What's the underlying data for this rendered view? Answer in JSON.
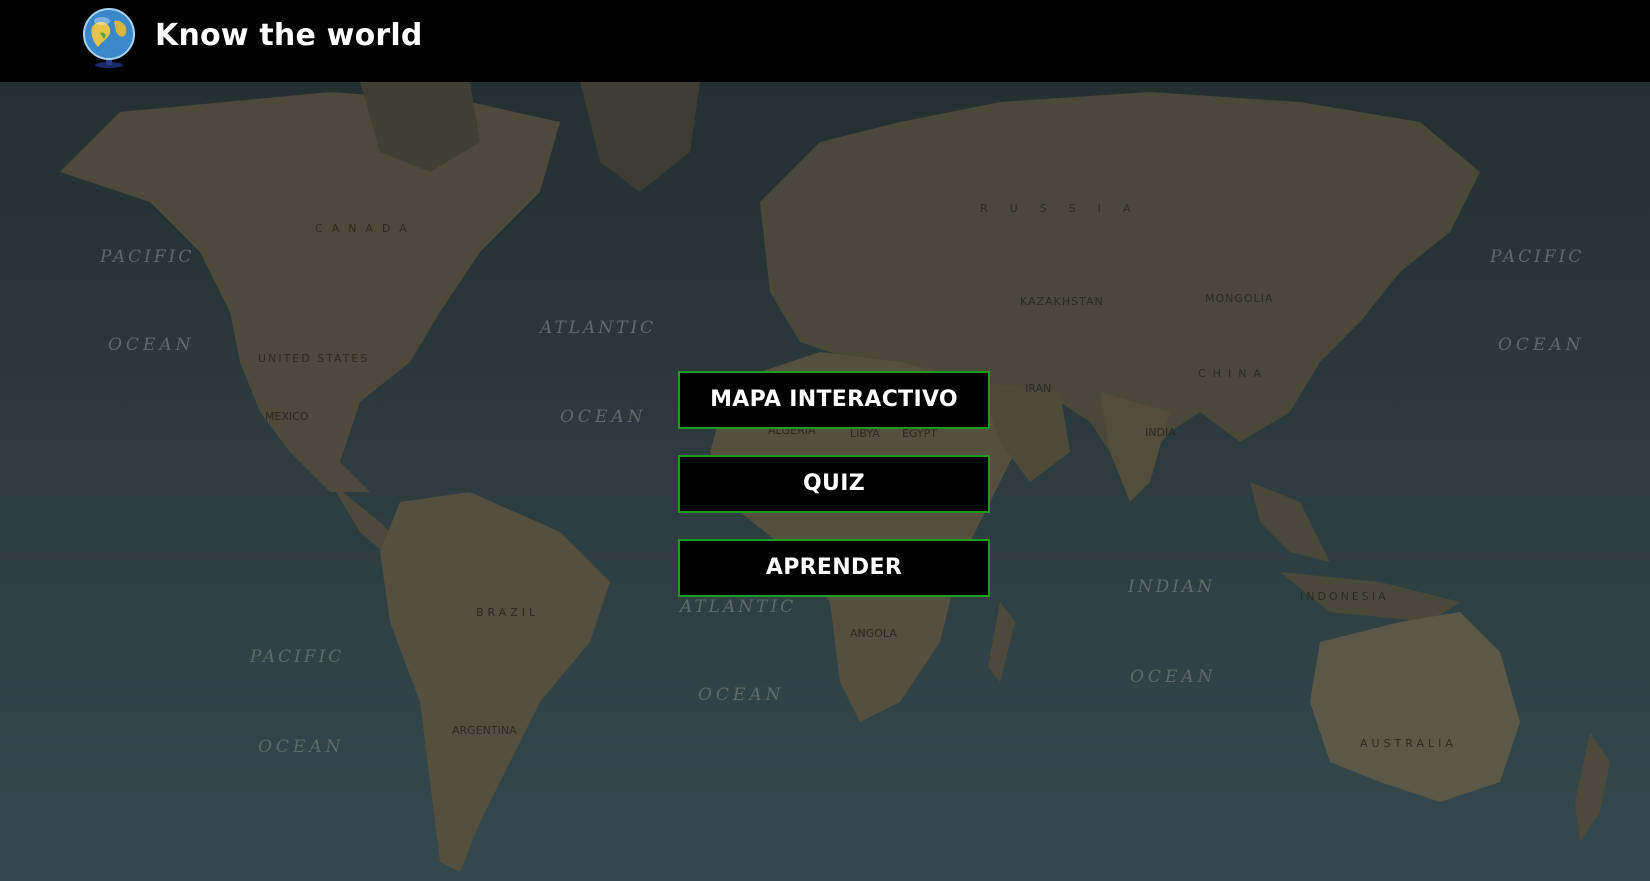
{
  "header": {
    "title": "Know the world",
    "logo_icon": "globe-icon"
  },
  "menu": {
    "items": [
      {
        "label": "MAPA INTERACTIVO"
      },
      {
        "label": "QUIZ"
      },
      {
        "label": "APRENDER"
      }
    ]
  },
  "map": {
    "oceans": [
      "PACIFIC",
      "OCEAN",
      "ATLANTIC",
      "OCEAN",
      "INDIAN",
      "OCEAN",
      "PACIFIC",
      "OCEAN",
      "ATLANTIC",
      "OCEAN",
      "PACIFIC",
      "OCEAN"
    ],
    "countries": [
      "CANADA",
      "UNITED STATES",
      "RUSSIA",
      "CHINA",
      "BRAZIL",
      "AUSTRALIA",
      "INDONESIA",
      "INDIA",
      "KAZAKHSTAN",
      "MONGOLIA",
      "IRAN",
      "MEXICO",
      "ARGENTINA",
      "ANGOLA",
      "ALGERIA",
      "LIBYA",
      "EGYPT"
    ]
  },
  "colors": {
    "header_bg": "#000000",
    "button_border": "#1f9a1f",
    "button_bg": "#000000",
    "ocean": "#2b3a3d",
    "land": "#5c5a47"
  }
}
